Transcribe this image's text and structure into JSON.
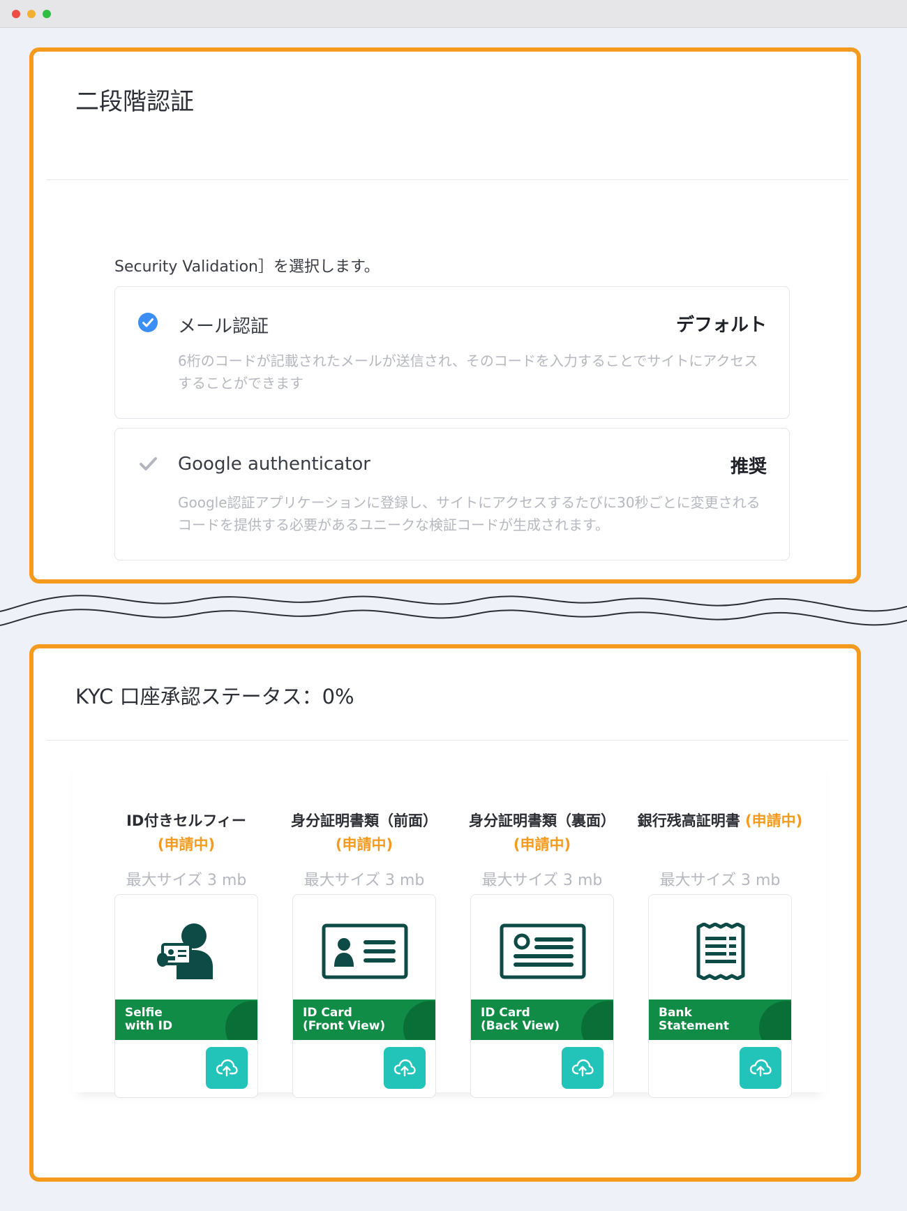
{
  "twofa": {
    "title": "二段階認証",
    "instruction": "Security Validation］を選択します。",
    "methods": [
      {
        "name": "メール認証",
        "tag": "デフォルト",
        "description": "6桁のコードが記載されたメールが送信され、そのコードを入力することでサイトにアクセスすることができます",
        "selected": true,
        "icon": "check-circle-icon"
      },
      {
        "name": "Google authenticator",
        "tag": "推奨",
        "description": "Google認証アプリケーションに登録し、サイトにアクセスするたびに30秒ごとに変更されるコードを提供する必要があるユニークな検証コードが生成されます。",
        "selected": false,
        "icon": "check-icon"
      }
    ]
  },
  "kyc": {
    "title": "KYC 口座承認ステータス：0%",
    "documents": [
      {
        "label": "ID付きセルフィー",
        "status": "(申請中)",
        "size": "最大サイズ 3 mb",
        "banner": "Selfie\nwith ID",
        "icon": "selfie-id-icon"
      },
      {
        "label": "身分証明書類（前面）",
        "status": "(申請中)",
        "size": "最大サイズ 3 mb",
        "banner": "ID Card\n(Front View)",
        "icon": "id-card-front-icon"
      },
      {
        "label": "身分証明書類（裏面）",
        "status": "(申請中)",
        "size": "最大サイズ 3 mb",
        "banner": "ID Card\n(Back View)",
        "icon": "id-card-back-icon"
      },
      {
        "label": "銀行残高証明書",
        "status": "(申請中)",
        "size": "最大サイズ 3 mb",
        "banner": "Bank\nStatement",
        "icon": "bank-statement-icon"
      }
    ]
  },
  "colors": {
    "highlight": "#f49a1f",
    "selected": "#3a8ef6",
    "banner": "#118c46",
    "upload": "#22c3b9"
  }
}
